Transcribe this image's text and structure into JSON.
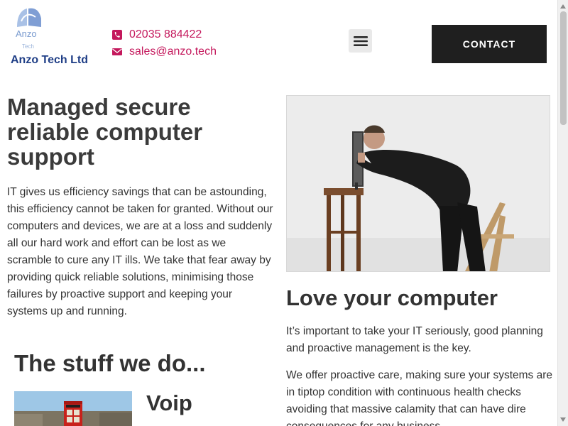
{
  "header": {
    "logo_word": "Anzo",
    "logo_sub": "Tech",
    "brand_name": "Anzo Tech Ltd",
    "phone": "02035 884422",
    "email": "sales@anzo.tech",
    "contact_label": "CONTACT",
    "icons": [
      "phone-icon",
      "envelope-icon",
      "hamburger-menu-icon"
    ],
    "accent_color": "#c4185c",
    "brand_color": "#1f3e86"
  },
  "hero": {
    "title": "Managed secure reliable computer support",
    "body": "IT gives us efficiency savings that can be astounding, this efficiency cannot be taken for granted.  Without our computers and devices, we are at a loss and suddenly all our hard work and effort can be lost as we scramble to cure any IT ills.  We take that fear away by providing quick reliable solutions, minimising those failures by proactive support and keeping your systems up and running."
  },
  "love": {
    "title": "Love your computer",
    "paragraph_1": "It’s important to take your IT seriously, good planning and proactive management is the key.",
    "paragraph_2": "We offer proactive care, making sure your systems are in tiptop condition with continuous health checks avoiding that massive calamity that can have dire consequences for any business."
  },
  "services": {
    "title": "The stuff we do...",
    "items": [
      {
        "title": "Voip"
      }
    ]
  }
}
